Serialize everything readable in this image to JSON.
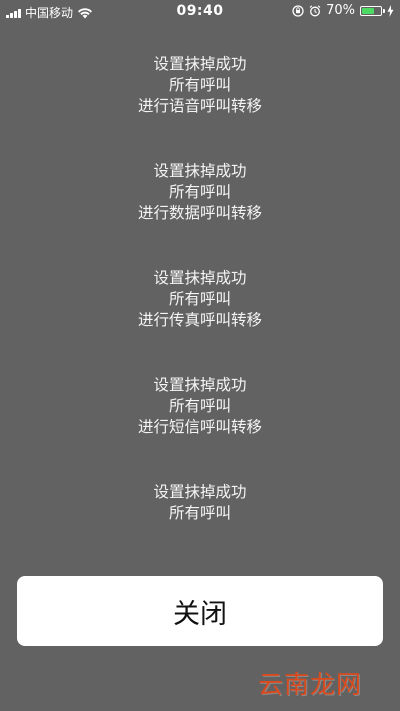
{
  "status_bar": {
    "carrier": "中国移动",
    "time": "09:40",
    "battery_percent": "70%",
    "battery_level": 0.7,
    "icons": [
      "signal-icon",
      "wifi-icon",
      "rotation-lock-icon",
      "alarm-icon",
      "battery-icon",
      "charging-icon"
    ]
  },
  "messages": [
    {
      "line1": "设置抹掉成功",
      "line2": "所有呼叫",
      "line3": "进行语音呼叫转移"
    },
    {
      "line1": "设置抹掉成功",
      "line2": "所有呼叫",
      "line3": "进行数据呼叫转移"
    },
    {
      "line1": "设置抹掉成功",
      "line2": "所有呼叫",
      "line3": "进行传真呼叫转移"
    },
    {
      "line1": "设置抹掉成功",
      "line2": "所有呼叫",
      "line3": "进行短信呼叫转移"
    },
    {
      "line1": "设置抹掉成功",
      "line2": "所有呼叫",
      "line3": ""
    }
  ],
  "close_button": {
    "label": "关闭"
  },
  "watermark": {
    "text": "云南龙网"
  },
  "colors": {
    "background": "#626262",
    "button_bg": "#ffffff",
    "battery_fill": "#4cd964",
    "watermark": "#d94a1e"
  }
}
